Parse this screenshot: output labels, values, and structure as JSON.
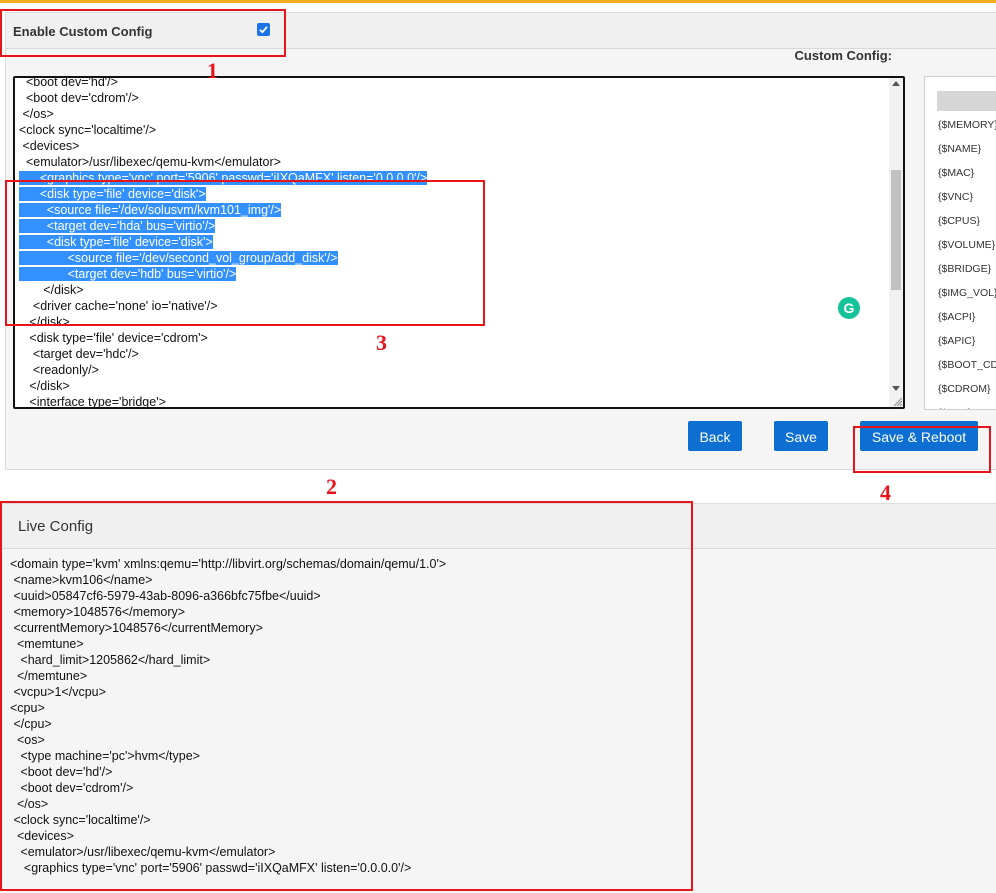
{
  "header": {
    "enable_label": "Enable Custom Config",
    "enabled": true,
    "custom_config_label": "Custom Config:"
  },
  "editor": {
    "selected_lines": [
      6,
      7,
      8,
      9,
      10,
      11,
      12
    ],
    "lines": [
      "  <boot dev='hd'/>",
      "  <boot dev='cdrom'/>",
      " </os>",
      "<clock sync='localtime'/>",
      " <devices>",
      "  <emulator>/usr/libexec/qemu-kvm</emulator>",
      "   <graphics type='vnc' port='5906' passwd='iIXQaMFX' listen='0.0.0.0'/>",
      "   <disk type='file' device='disk'>",
      "    <source file='/dev/solusvm/kvm101_img'/>",
      "    <target dev='hda' bus='virtio'/>",
      "    <disk type='file' device='disk'>",
      "       <source file='/dev/second_vol_group/add_disk'/>",
      "       <target dev='hdb' bus='virtio'/>",
      "       </disk>",
      "    <driver cache='none' io='native'/>",
      "   </disk>",
      "   <disk type='file' device='cdrom'>",
      "    <target dev='hdc'/>",
      "    <readonly/>",
      "   </disk>",
      "   <interface type='bridge'>"
    ]
  },
  "variables": [
    "{$MEMORY}",
    "{$NAME}",
    "{$MAC}",
    "{$VNC}",
    "{$CPUS}",
    "{$VOLUME}",
    "{$BRIDGE}",
    "{$IMG_VOL}",
    "{$ACPI}",
    "{$APIC}",
    "{$BOOT_CD}",
    "{$CDROM}",
    "{$PAE}"
  ],
  "buttons": {
    "back": "Back",
    "save": "Save",
    "save_reboot": "Save & Reboot"
  },
  "live": {
    "title": "Live Config",
    "lines": [
      "<domain type='kvm' xmlns:qemu='http://libvirt.org/schemas/domain/qemu/1.0'>",
      " <name>kvm106</name>",
      " <uuid>05847cf6-5979-43ab-8096-a366bfc75fbe</uuid>",
      " <memory>1048576</memory>",
      " <currentMemory>1048576</currentMemory>",
      "  <memtune>",
      "   <hard_limit>1205862</hard_limit>",
      "  </memtune>",
      " <vcpu>1</vcpu>",
      "<cpu>",
      " </cpu>",
      "  <os>",
      "   <type machine='pc'>hvm</type>",
      "   <boot dev='hd'/>",
      "   <boot dev='cdrom'/>",
      "  </os>",
      " <clock sync='localtime'/>",
      "  <devices>",
      "   <emulator>/usr/libexec/qemu-kvm</emulator>",
      "    <graphics type='vnc' port='5906' passwd='iIXQaMFX' listen='0.0.0.0'/>"
    ]
  },
  "annotations": [
    "1",
    "2",
    "3",
    "4"
  ],
  "colors": {
    "accent": "#0d6fd1",
    "highlight": "#e8141c",
    "selection": "#3390ff"
  }
}
